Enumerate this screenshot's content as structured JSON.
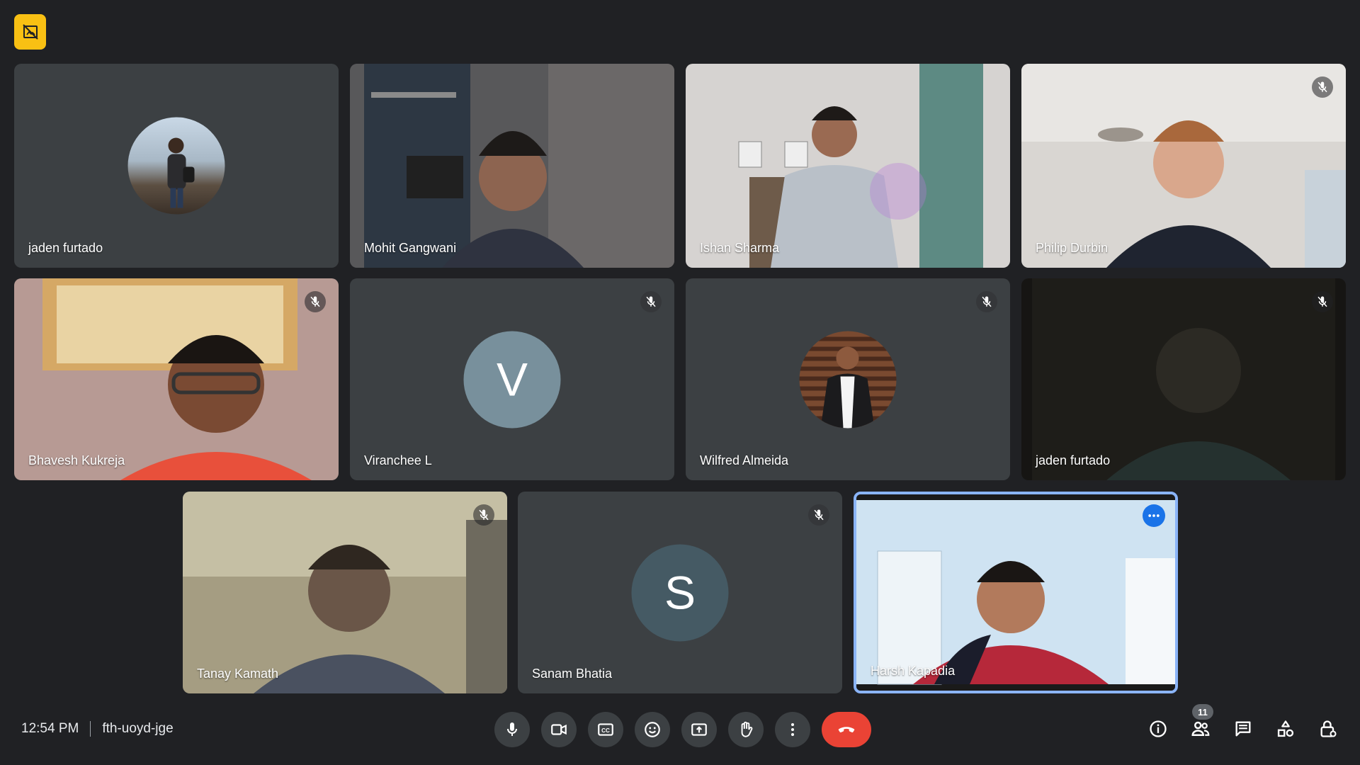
{
  "participants": [
    {
      "name": "jaden furtado"
    },
    {
      "name": "Mohit Gangwani"
    },
    {
      "name": "Ishan Sharma"
    },
    {
      "name": "Philip Durbin"
    },
    {
      "name": "Bhavesh Kukreja"
    },
    {
      "name": "Viranchee L",
      "initial": "V",
      "avatar_color": "#78909c"
    },
    {
      "name": "Wilfred Almeida"
    },
    {
      "name": "jaden furtado"
    },
    {
      "name": "Tanay Kamath"
    },
    {
      "name": "Sanam Bhatia",
      "initial": "S",
      "avatar_color": "#455a64"
    },
    {
      "name": "Harsh Kapadia"
    }
  ],
  "meeting": {
    "time": "12:54 PM",
    "code": "fth-uoyd-jge"
  },
  "people_count": "11",
  "colors": {
    "background": "#202124",
    "tile": "#3c4043",
    "end_call": "#ea4335",
    "accent_blue": "#1a73e8",
    "badge_yellow": "#f9c013"
  },
  "icons": {
    "top_left": "no-video-badge-icon",
    "controls": [
      "mic-icon",
      "camera-icon",
      "captions-icon",
      "emoji-icon",
      "present-icon",
      "raise-hand-icon",
      "more-vert-icon",
      "end-call-icon"
    ],
    "right": [
      "info-icon",
      "people-icon",
      "chat-icon",
      "activities-icon",
      "host-controls-icon"
    ]
  }
}
